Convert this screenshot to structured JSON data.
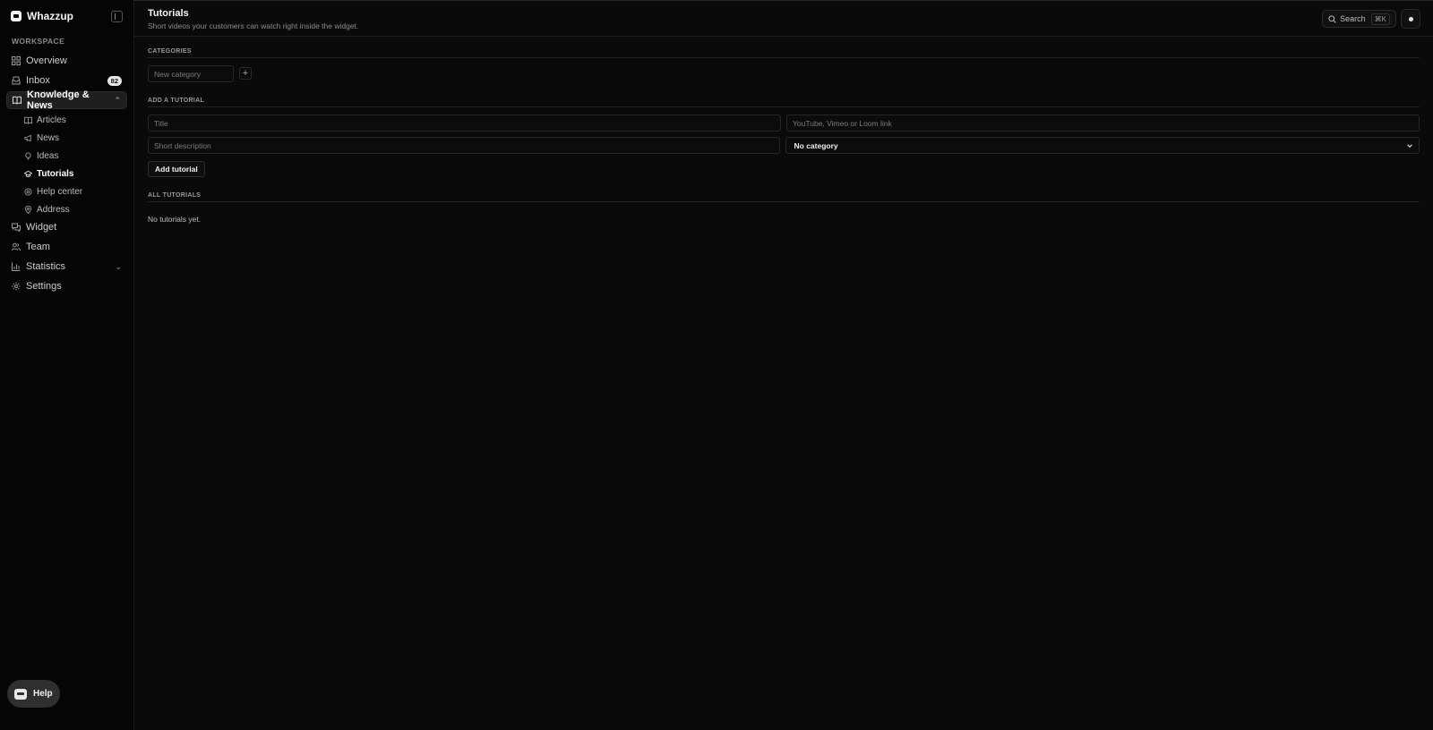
{
  "brand": {
    "name": "Whazzup"
  },
  "sidebar": {
    "section_label": "WORKSPACE",
    "items": [
      {
        "label": "Overview"
      },
      {
        "label": "Inbox",
        "badge": "82"
      },
      {
        "label": "Knowledge & News"
      },
      {
        "label": "Widget"
      },
      {
        "label": "Team"
      },
      {
        "label": "Statistics"
      },
      {
        "label": "Settings"
      }
    ],
    "sub_items": [
      {
        "label": "Articles"
      },
      {
        "label": "News"
      },
      {
        "label": "Ideas"
      },
      {
        "label": "Tutorials"
      },
      {
        "label": "Help center"
      },
      {
        "label": "Address"
      }
    ],
    "help_label": "Help"
  },
  "header": {
    "title": "Tutorials",
    "subtitle": "Short videos your customers can watch right inside the widget.",
    "search_label": "Search",
    "search_shortcut": "⌘K"
  },
  "categories": {
    "heading": "CATEGORIES",
    "new_placeholder": "New category",
    "add_symbol": "+"
  },
  "add_tutorial": {
    "heading": "ADD A TUTORIAL",
    "title_placeholder": "Title",
    "link_placeholder": "YouTube, Vimeo or Loom link",
    "description_placeholder": "Short description",
    "category_selected": "No category",
    "submit_label": "Add tutorial"
  },
  "all_tutorials": {
    "heading": "ALL TUTORIALS",
    "empty_text": "No tutorials yet."
  },
  "colors": {
    "background": "#0a0a0a",
    "sidebar": "#050505",
    "active_item": "#1f1f1f",
    "text": "#e8e8e8"
  }
}
